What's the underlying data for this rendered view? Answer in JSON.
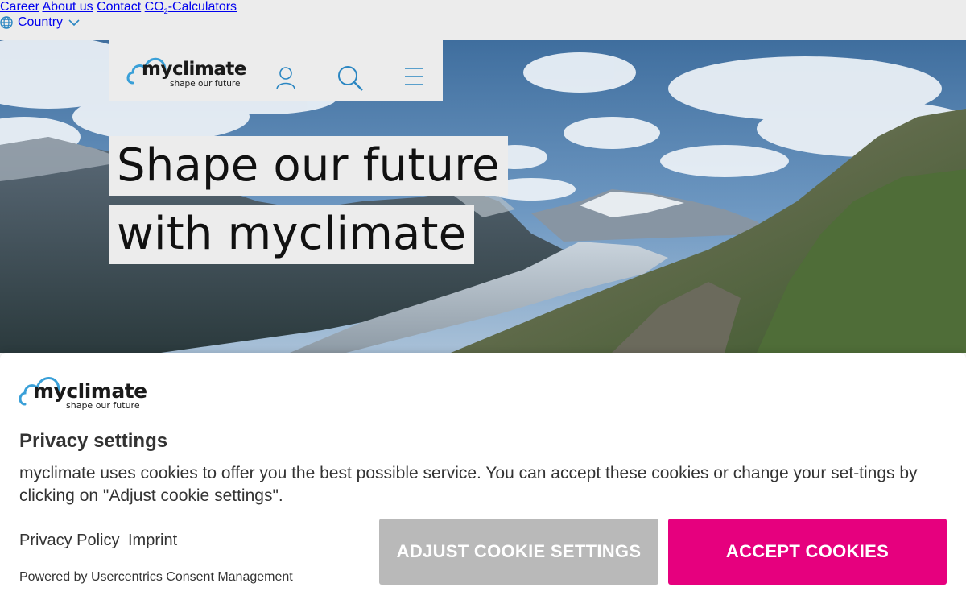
{
  "topnav": {
    "career": "Career",
    "about": "About us",
    "contact": "Contact",
    "co2_prefix": "CO",
    "co2_sub": "2",
    "co2_suffix": "-Calculators",
    "country": "Country"
  },
  "header": {
    "logo_name": "myclimate",
    "logo_tagline": "shape our future",
    "icons": [
      "user-icon",
      "search-icon",
      "menu-icon"
    ]
  },
  "hero": {
    "line1": "Shape our future",
    "line2": "with myclimate"
  },
  "consent": {
    "logo_name": "myclimate",
    "logo_tagline": "shape our future",
    "title": "Privacy settings",
    "description": "myclimate uses cookies to offer you the best possible service. You can accept these cookies or change your set-tings by clicking on \"Adjust cookie settings\".",
    "privacy_policy": "Privacy Policy",
    "imprint": "Imprint",
    "powered_by": "Powered by Usercentrics Consent Management",
    "adjust_button": "ADJUST COOKIE SETTINGS",
    "accept_button": "ACCEPT COOKIES"
  },
  "colors": {
    "link_blue": "#2a86c2",
    "accent_pink": "#e6007e",
    "button_grey": "#b9b9b9",
    "logo_cloud": "#3aa0d8"
  }
}
